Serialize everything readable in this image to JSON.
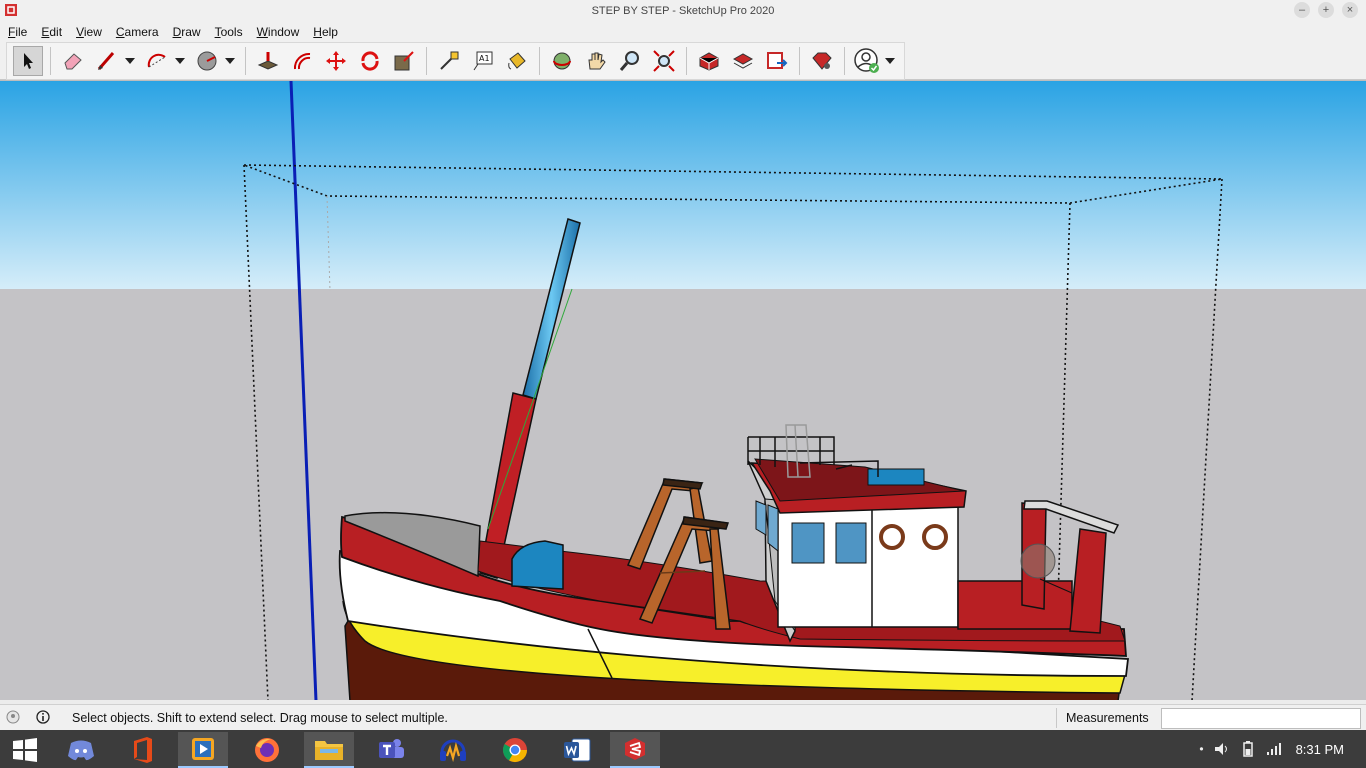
{
  "window": {
    "title": "STEP BY STEP - SketchUp Pro 2020"
  },
  "menu": {
    "items": [
      {
        "label": "File"
      },
      {
        "label": "Edit"
      },
      {
        "label": "View"
      },
      {
        "label": "Camera"
      },
      {
        "label": "Draw"
      },
      {
        "label": "Tools"
      },
      {
        "label": "Window"
      },
      {
        "label": "Help"
      }
    ]
  },
  "toolbar": {
    "tools": [
      "select-tool-icon",
      "eraser-tool-icon",
      "line-tool-icon",
      "arc-tool-icon",
      "shapes-tool-icon",
      "push-pull-tool-icon",
      "offset-tool-icon",
      "move-tool-icon",
      "rotate-tool-icon",
      "scale-tool-icon",
      "tape-measure-tool-icon",
      "text-tool-icon",
      "paint-bucket-tool-icon",
      "orbit-tool-icon",
      "pan-tool-icon",
      "zoom-tool-icon",
      "zoom-extents-tool-icon",
      "3d-warehouse-icon",
      "extension-warehouse-icon",
      "layout-send-icon",
      "extension-manager-icon",
      "account-icon"
    ]
  },
  "statusbar": {
    "hint": "Select objects. Shift to extend select. Drag mouse to select multiple.",
    "measurements_label": "Measurements",
    "measurements_value": ""
  },
  "taskbar": {
    "apps": [
      "start-icon",
      "discord-icon",
      "office-icon",
      "media-player-icon",
      "firefox-icon",
      "file-explorer-icon",
      "teams-icon",
      "audio-app-icon",
      "chrome-icon",
      "word-icon",
      "sketchup-icon"
    ],
    "time": "8:31 PM"
  },
  "colors": {
    "sky_top": "#2aa3e4",
    "ground": "#c4c3c6",
    "hull_red": "#b81f23",
    "hull_white": "#ffffff",
    "stripe_yellow": "#f7ef2a",
    "selection_box": "#111111"
  }
}
